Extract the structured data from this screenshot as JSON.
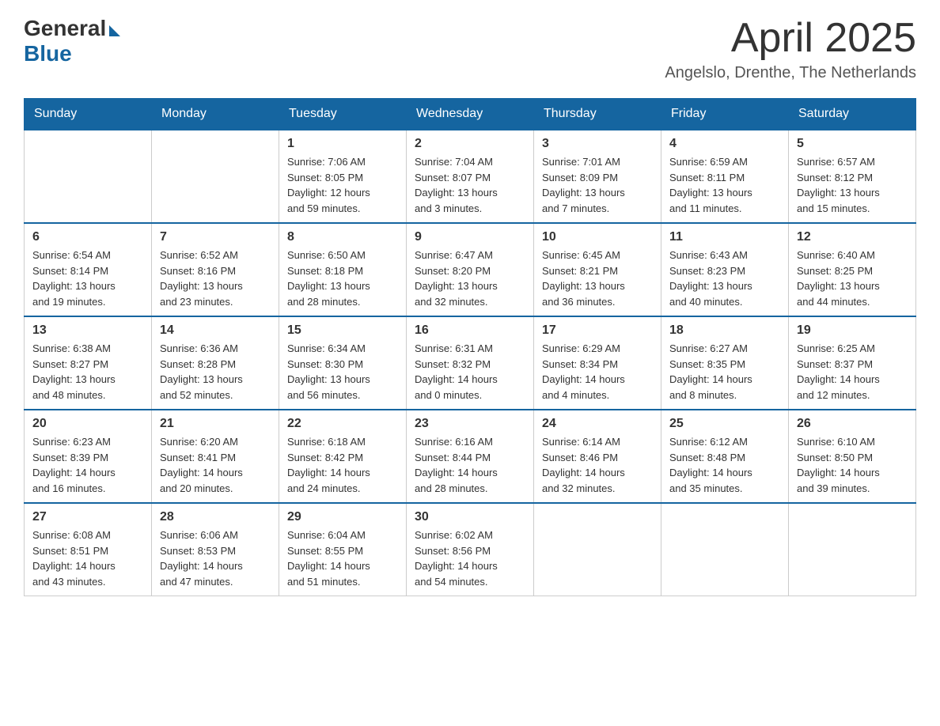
{
  "logo": {
    "general": "General",
    "blue": "Blue"
  },
  "header": {
    "month": "April 2025",
    "location": "Angelslo, Drenthe, The Netherlands"
  },
  "weekdays": [
    "Sunday",
    "Monday",
    "Tuesday",
    "Wednesday",
    "Thursday",
    "Friday",
    "Saturday"
  ],
  "weeks": [
    [
      {
        "day": "",
        "info": ""
      },
      {
        "day": "",
        "info": ""
      },
      {
        "day": "1",
        "info": "Sunrise: 7:06 AM\nSunset: 8:05 PM\nDaylight: 12 hours\nand 59 minutes."
      },
      {
        "day": "2",
        "info": "Sunrise: 7:04 AM\nSunset: 8:07 PM\nDaylight: 13 hours\nand 3 minutes."
      },
      {
        "day": "3",
        "info": "Sunrise: 7:01 AM\nSunset: 8:09 PM\nDaylight: 13 hours\nand 7 minutes."
      },
      {
        "day": "4",
        "info": "Sunrise: 6:59 AM\nSunset: 8:11 PM\nDaylight: 13 hours\nand 11 minutes."
      },
      {
        "day": "5",
        "info": "Sunrise: 6:57 AM\nSunset: 8:12 PM\nDaylight: 13 hours\nand 15 minutes."
      }
    ],
    [
      {
        "day": "6",
        "info": "Sunrise: 6:54 AM\nSunset: 8:14 PM\nDaylight: 13 hours\nand 19 minutes."
      },
      {
        "day": "7",
        "info": "Sunrise: 6:52 AM\nSunset: 8:16 PM\nDaylight: 13 hours\nand 23 minutes."
      },
      {
        "day": "8",
        "info": "Sunrise: 6:50 AM\nSunset: 8:18 PM\nDaylight: 13 hours\nand 28 minutes."
      },
      {
        "day": "9",
        "info": "Sunrise: 6:47 AM\nSunset: 8:20 PM\nDaylight: 13 hours\nand 32 minutes."
      },
      {
        "day": "10",
        "info": "Sunrise: 6:45 AM\nSunset: 8:21 PM\nDaylight: 13 hours\nand 36 minutes."
      },
      {
        "day": "11",
        "info": "Sunrise: 6:43 AM\nSunset: 8:23 PM\nDaylight: 13 hours\nand 40 minutes."
      },
      {
        "day": "12",
        "info": "Sunrise: 6:40 AM\nSunset: 8:25 PM\nDaylight: 13 hours\nand 44 minutes."
      }
    ],
    [
      {
        "day": "13",
        "info": "Sunrise: 6:38 AM\nSunset: 8:27 PM\nDaylight: 13 hours\nand 48 minutes."
      },
      {
        "day": "14",
        "info": "Sunrise: 6:36 AM\nSunset: 8:28 PM\nDaylight: 13 hours\nand 52 minutes."
      },
      {
        "day": "15",
        "info": "Sunrise: 6:34 AM\nSunset: 8:30 PM\nDaylight: 13 hours\nand 56 minutes."
      },
      {
        "day": "16",
        "info": "Sunrise: 6:31 AM\nSunset: 8:32 PM\nDaylight: 14 hours\nand 0 minutes."
      },
      {
        "day": "17",
        "info": "Sunrise: 6:29 AM\nSunset: 8:34 PM\nDaylight: 14 hours\nand 4 minutes."
      },
      {
        "day": "18",
        "info": "Sunrise: 6:27 AM\nSunset: 8:35 PM\nDaylight: 14 hours\nand 8 minutes."
      },
      {
        "day": "19",
        "info": "Sunrise: 6:25 AM\nSunset: 8:37 PM\nDaylight: 14 hours\nand 12 minutes."
      }
    ],
    [
      {
        "day": "20",
        "info": "Sunrise: 6:23 AM\nSunset: 8:39 PM\nDaylight: 14 hours\nand 16 minutes."
      },
      {
        "day": "21",
        "info": "Sunrise: 6:20 AM\nSunset: 8:41 PM\nDaylight: 14 hours\nand 20 minutes."
      },
      {
        "day": "22",
        "info": "Sunrise: 6:18 AM\nSunset: 8:42 PM\nDaylight: 14 hours\nand 24 minutes."
      },
      {
        "day": "23",
        "info": "Sunrise: 6:16 AM\nSunset: 8:44 PM\nDaylight: 14 hours\nand 28 minutes."
      },
      {
        "day": "24",
        "info": "Sunrise: 6:14 AM\nSunset: 8:46 PM\nDaylight: 14 hours\nand 32 minutes."
      },
      {
        "day": "25",
        "info": "Sunrise: 6:12 AM\nSunset: 8:48 PM\nDaylight: 14 hours\nand 35 minutes."
      },
      {
        "day": "26",
        "info": "Sunrise: 6:10 AM\nSunset: 8:50 PM\nDaylight: 14 hours\nand 39 minutes."
      }
    ],
    [
      {
        "day": "27",
        "info": "Sunrise: 6:08 AM\nSunset: 8:51 PM\nDaylight: 14 hours\nand 43 minutes."
      },
      {
        "day": "28",
        "info": "Sunrise: 6:06 AM\nSunset: 8:53 PM\nDaylight: 14 hours\nand 47 minutes."
      },
      {
        "day": "29",
        "info": "Sunrise: 6:04 AM\nSunset: 8:55 PM\nDaylight: 14 hours\nand 51 minutes."
      },
      {
        "day": "30",
        "info": "Sunrise: 6:02 AM\nSunset: 8:56 PM\nDaylight: 14 hours\nand 54 minutes."
      },
      {
        "day": "",
        "info": ""
      },
      {
        "day": "",
        "info": ""
      },
      {
        "day": "",
        "info": ""
      }
    ]
  ]
}
